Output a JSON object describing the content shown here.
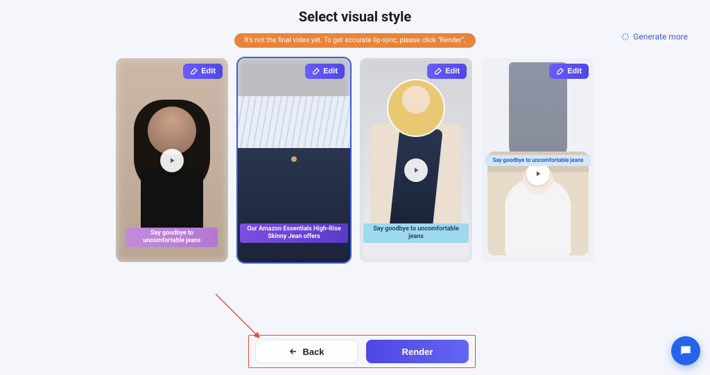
{
  "title": "Select visual style",
  "notice": "It's not the final video yet. To get accurate lip-sync, please click \"Render\".",
  "generate_more": "Generate more",
  "edit_label": "Edit",
  "cards": [
    {
      "caption": "Say goodbye to uncomfortable jeans",
      "selected": false
    },
    {
      "caption": "Our Amazon Essentials High-Rise Skinny Jean offers",
      "selected": true
    },
    {
      "caption": "Say goodbye to uncomfortable jeans",
      "selected": false
    },
    {
      "caption": "Say goodbye to uncomfortable jeans",
      "selected": false
    }
  ],
  "footer": {
    "back": "Back",
    "render": "Render"
  }
}
